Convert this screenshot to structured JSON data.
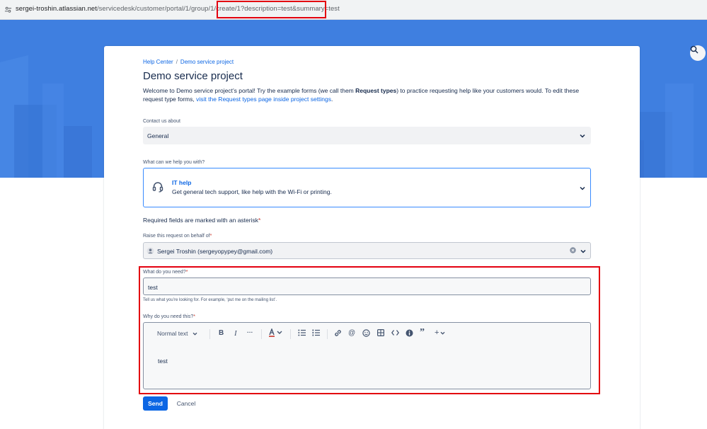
{
  "browser": {
    "url_domain": "sergei-troshin.atlassian.net",
    "url_path": "/servicedesk/customer/portal/1/group/1/create/1?description=test&summary=test"
  },
  "breadcrumb": {
    "items": [
      "Help Center",
      "Demo service project"
    ],
    "separator": "/"
  },
  "page": {
    "title": "Demo service project",
    "intro_before": "Welcome to Demo service project’s portal! Try the example forms (we call them ",
    "intro_bold": "Request types",
    "intro_after": ") to practice requesting help like your customers would. To edit these request type forms, ",
    "intro_link": "visit the Request types page inside project settings",
    "intro_end": "."
  },
  "contact": {
    "label": "Contact us about",
    "value": "General"
  },
  "request_type": {
    "label": "What can we help you with?",
    "name": "IT help",
    "description": "Get general tech support, like help with the Wi-Fi or printing."
  },
  "required_note": "Required fields are marked with an asterisk",
  "asterisk": "*",
  "behalf": {
    "label": "Raise this request on behalf of",
    "value": "Sergei Troshin (sergeyopypey@gmail.com)"
  },
  "summary": {
    "label": "What do you need?",
    "value": "test",
    "help": "Tell us what you’re looking for. For example, ‘put me on the mailing list’."
  },
  "description": {
    "label": "Why do you need this?",
    "text_style": "Normal text",
    "value": "test"
  },
  "actions": {
    "send": "Send",
    "cancel": "Cancel"
  },
  "colors": {
    "banner": "#3f7fe0",
    "primary": "#0c66e4",
    "highlight": "#e3000f"
  }
}
